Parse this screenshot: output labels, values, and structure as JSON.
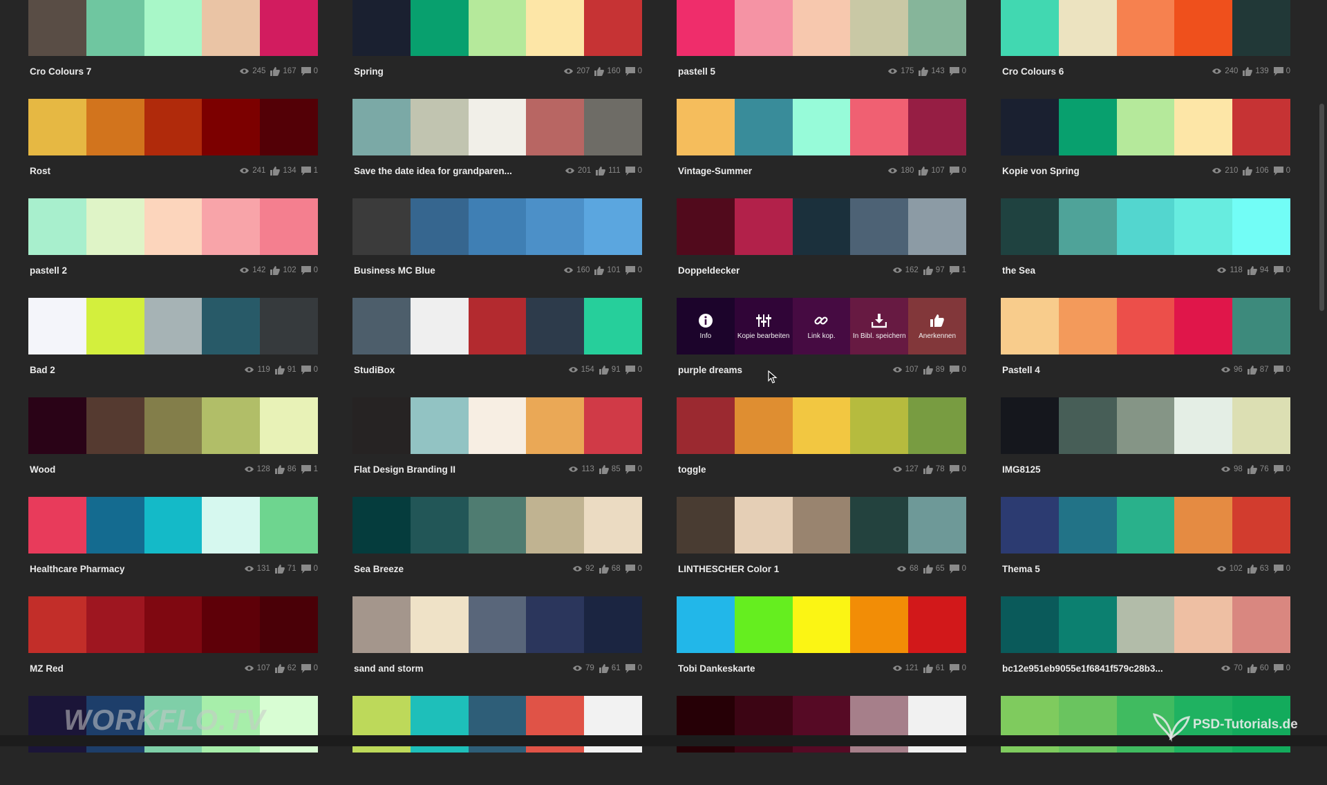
{
  "colors": {
    "background": "#262626",
    "text": "#ececec",
    "muted": "#8a8a8a"
  },
  "icons": {
    "views": "eye-icon",
    "likes": "thumbs-up-icon",
    "comments": "comment-icon"
  },
  "palettes": [
    {
      "name": "Cro Colours 7",
      "views": "245",
      "likes": "167",
      "comments": "0",
      "colors": [
        "#594d45",
        "#6fc6a0",
        "#a8f7c8",
        "#eac4a5",
        "#d21c5f"
      ]
    },
    {
      "name": "Spring",
      "views": "207",
      "likes": "160",
      "comments": "0",
      "colors": [
        "#1a2030",
        "#08a06e",
        "#b5e99b",
        "#fde6a7",
        "#c63334"
      ]
    },
    {
      "name": "pastell 5",
      "views": "175",
      "likes": "143",
      "comments": "0",
      "colors": [
        "#ef2d6b",
        "#f593a4",
        "#f7c8ae",
        "#c9c8a5",
        "#86b59a"
      ]
    },
    {
      "name": "Cro Colours 6",
      "views": "240",
      "likes": "139",
      "comments": "0",
      "colors": [
        "#41d8b1",
        "#ece3c0",
        "#f6814f",
        "#ef501c",
        "#213837"
      ]
    },
    {
      "name": "Rost",
      "views": "241",
      "likes": "134",
      "comments": "1",
      "colors": [
        "#e6b843",
        "#d2741d",
        "#b02a0b",
        "#7c0000",
        "#530006"
      ]
    },
    {
      "name": "Save the date idea for grandparen...",
      "views": "201",
      "likes": "111",
      "comments": "0",
      "colors": [
        "#7ba9a6",
        "#c1c4b0",
        "#f1efe8",
        "#b86663",
        "#6e6c66"
      ]
    },
    {
      "name": "Vintage-Summer",
      "views": "180",
      "likes": "107",
      "comments": "0",
      "colors": [
        "#f5bd5c",
        "#398c9a",
        "#97fbd9",
        "#f06072",
        "#961e44"
      ]
    },
    {
      "name": "Kopie von Spring",
      "views": "210",
      "likes": "106",
      "comments": "0",
      "colors": [
        "#1a2030",
        "#08a06e",
        "#b5e99b",
        "#fde6a7",
        "#c63334"
      ]
    },
    {
      "name": "pastell 2",
      "views": "142",
      "likes": "102",
      "comments": "0",
      "colors": [
        "#a8efcd",
        "#dff4c7",
        "#fcd5bc",
        "#f8a4a9",
        "#f47f8f"
      ]
    },
    {
      "name": "Business MC Blue",
      "views": "160",
      "likes": "101",
      "comments": "0",
      "colors": [
        "#3b3b3b",
        "#36668f",
        "#3f7fb4",
        "#4c90c8",
        "#5ba6df"
      ]
    },
    {
      "name": "Doppeldecker",
      "views": "162",
      "likes": "97",
      "comments": "1",
      "colors": [
        "#510a1c",
        "#b2214a",
        "#1b303c",
        "#4d6275",
        "#8c9ba5"
      ]
    },
    {
      "name": "the Sea",
      "views": "118",
      "likes": "94",
      "comments": "0",
      "colors": [
        "#1f4240",
        "#4fa399",
        "#53d6cf",
        "#67ecdf",
        "#72fdf6"
      ]
    },
    {
      "name": "Bad 2",
      "views": "119",
      "likes": "91",
      "comments": "0",
      "colors": [
        "#f4f5fa",
        "#d3ef3d",
        "#a6b3b5",
        "#285a68",
        "#363a3d"
      ]
    },
    {
      "name": "StudiBox",
      "views": "154",
      "likes": "91",
      "comments": "0",
      "colors": [
        "#4d5e6b",
        "#efefef",
        "#b32a2f",
        "#2d3b4b",
        "#26cf9b"
      ]
    },
    {
      "name": "purple dreams",
      "views": "107",
      "likes": "89",
      "comments": "0",
      "colors": [
        "#0f0929",
        "#3b0d44",
        "#6b1a5b",
        "#b33a5b",
        "#ef7a4a"
      ]
    },
    {
      "name": "Pastell 4",
      "views": "96",
      "likes": "87",
      "comments": "0",
      "colors": [
        "#f8cc8c",
        "#f39a5b",
        "#ec4f4a",
        "#e0164a",
        "#3d8a7c"
      ]
    },
    {
      "name": "Wood",
      "views": "128",
      "likes": "86",
      "comments": "1",
      "colors": [
        "#2a0317",
        "#553a30",
        "#837e4a",
        "#b1be68",
        "#e8f2b7"
      ]
    },
    {
      "name": "Flat Design Branding II",
      "views": "113",
      "likes": "85",
      "comments": "0",
      "colors": [
        "#262323",
        "#92c3c3",
        "#f7eee3",
        "#eaa856",
        "#d03a47"
      ]
    },
    {
      "name": "toggle",
      "views": "127",
      "likes": "78",
      "comments": "0",
      "colors": [
        "#9b2930",
        "#df8e31",
        "#f2c741",
        "#b6bb3e",
        "#789c41"
      ]
    },
    {
      "name": "IMG8125",
      "views": "98",
      "likes": "76",
      "comments": "0",
      "colors": [
        "#15171d",
        "#475e57",
        "#859586",
        "#e4eee5",
        "#dcdfb3"
      ]
    },
    {
      "name": "Healthcare Pharmacy",
      "views": "131",
      "likes": "71",
      "comments": "0",
      "colors": [
        "#e83b5b",
        "#146b90",
        "#14bac8",
        "#d6f8ef",
        "#6ed58f"
      ]
    },
    {
      "name": "Sea Breeze",
      "views": "92",
      "likes": "68",
      "comments": "0",
      "colors": [
        "#053c3d",
        "#225657",
        "#4f7c71",
        "#c0b391",
        "#ebdbc2"
      ]
    },
    {
      "name": "LINTHESCHER Color 1",
      "views": "68",
      "likes": "65",
      "comments": "0",
      "colors": [
        "#493c32",
        "#e5cfb6",
        "#99846f",
        "#23423e",
        "#6e9998"
      ]
    },
    {
      "name": "Thema 5",
      "views": "102",
      "likes": "63",
      "comments": "0",
      "colors": [
        "#2c3b71",
        "#227387",
        "#29b18b",
        "#e58b42",
        "#d23c2e"
      ]
    },
    {
      "name": "MZ Red",
      "views": "107",
      "likes": "62",
      "comments": "0",
      "colors": [
        "#c22e29",
        "#9e1620",
        "#7f0811",
        "#5e0008",
        "#4a0007"
      ]
    },
    {
      "name": "sand and storm",
      "views": "79",
      "likes": "61",
      "comments": "0",
      "colors": [
        "#a4968c",
        "#efe2c7",
        "#59667a",
        "#2b365c",
        "#1b2541"
      ]
    },
    {
      "name": "Tobi Dankeskarte",
      "views": "121",
      "likes": "61",
      "comments": "0",
      "colors": [
        "#22b7e9",
        "#65ee1f",
        "#fbf514",
        "#f28d06",
        "#d2181a"
      ]
    },
    {
      "name": "bc12e951eb9055e1f6841f579c28b3...",
      "views": "70",
      "likes": "60",
      "comments": "0",
      "colors": [
        "#0a5a5a",
        "#0c8070",
        "#b2bca9",
        "#eebfa3",
        "#d98780"
      ]
    },
    {
      "name": "",
      "views": "",
      "likes": "",
      "comments": "",
      "colors": [
        "#1b1538",
        "#1d3e6a",
        "#7fcfa8",
        "#a7eeaa",
        "#d8fdd3"
      ]
    },
    {
      "name": "",
      "views": "",
      "likes": "",
      "comments": "",
      "colors": [
        "#bdd95a",
        "#1ebfba",
        "#2e5e78",
        "#e05347",
        "#f2f2f2"
      ]
    },
    {
      "name": "",
      "views": "",
      "likes": "",
      "comments": "",
      "colors": [
        "#260006",
        "#3c0514",
        "#560a25",
        "#a67f8a",
        "#f1f1f1"
      ]
    },
    {
      "name": "",
      "views": "",
      "likes": "",
      "comments": "",
      "colors": [
        "#7fcb5e",
        "#6ac45f",
        "#40bb60",
        "#1fb261",
        "#13ab5c"
      ]
    }
  ],
  "hover_menu": {
    "palette": "purple dreams",
    "buttons": [
      {
        "label": "Info",
        "icon": "info-icon"
      },
      {
        "label": "Kopie bearbeiten",
        "icon": "sliders-icon"
      },
      {
        "label": "Link kop.",
        "icon": "link-icon"
      },
      {
        "label": "In Bibl. speichern",
        "icon": "download-icon"
      },
      {
        "label": "Anerkennen",
        "icon": "thumbs-up-icon"
      }
    ]
  },
  "watermarks": {
    "left": "WORKFLO.TV",
    "right": "PSD-Tutorials.de"
  }
}
